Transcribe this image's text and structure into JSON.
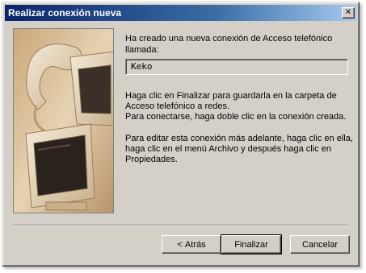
{
  "window": {
    "title": "Realizar conexión nueva",
    "close_glyph": "✕"
  },
  "content": {
    "intro": "Ha creado una nueva conexión de Acceso telefónico llamada:",
    "connection_name": "Keko",
    "para1_line1": "Haga clic en Finalizar para guardarla en la carpeta de",
    "para1_line2": "Acceso telefónico a redes.",
    "para1_line3": "Para conectarse, haga doble clic en la conexión creada.",
    "para2_line1": "Para editar esta conexión más adelante, haga clic en ella,",
    "para2_line2": "haga clic en el menú Archivo y después haga clic en",
    "para2_line3": "Propiedades."
  },
  "buttons": {
    "back_prefix": "< ",
    "back_label": "Atrás",
    "finish_label": "Finalizar",
    "cancel_label": "Cancelar"
  },
  "image": {
    "description_icon": "computer-monitor-icon",
    "tone_color": "#d9c3a0"
  }
}
